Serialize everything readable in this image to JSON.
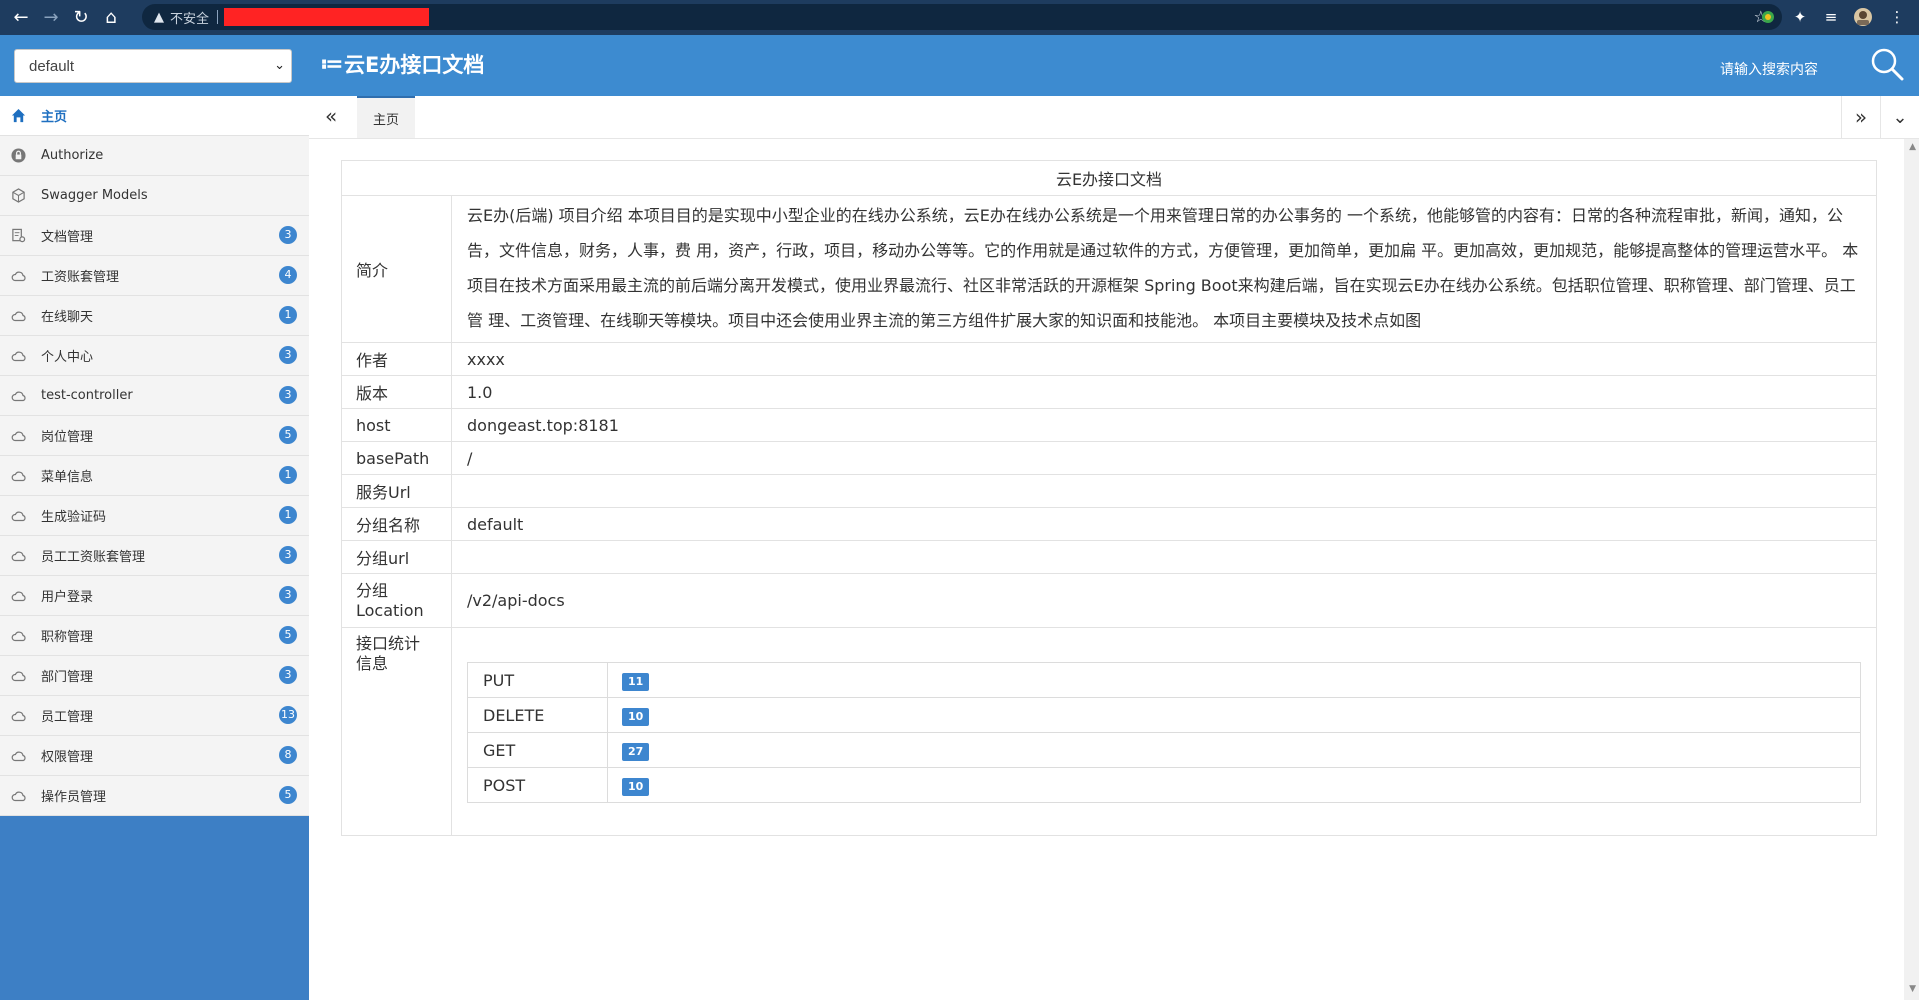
{
  "browser": {
    "insecure_label": "不安全",
    "colors": {
      "chrome": "#1e3c5f",
      "redaction": "#ff2323"
    }
  },
  "header": {
    "group_value": "default",
    "title": "云E办接口文档",
    "search_placeholder": "请输入搜索内容",
    "color": "#3d8bd0"
  },
  "sidebar": {
    "items": [
      {
        "label": "主页",
        "icon": "home-icon",
        "badge": null
      },
      {
        "label": "Authorize",
        "icon": "lock-icon",
        "badge": null
      },
      {
        "label": "Swagger Models",
        "icon": "cube-icon",
        "badge": null
      },
      {
        "label": "文档管理",
        "icon": "document-settings-icon",
        "badge": "3"
      },
      {
        "label": "工资账套管理",
        "icon": "cloud-icon",
        "badge": "4"
      },
      {
        "label": "在线聊天",
        "icon": "cloud-icon",
        "badge": "1"
      },
      {
        "label": "个人中心",
        "icon": "cloud-icon",
        "badge": "3"
      },
      {
        "label": "test-controller",
        "icon": "cloud-icon",
        "badge": "3"
      },
      {
        "label": "岗位管理",
        "icon": "cloud-icon",
        "badge": "5"
      },
      {
        "label": "菜单信息",
        "icon": "cloud-icon",
        "badge": "1"
      },
      {
        "label": "生成验证码",
        "icon": "cloud-icon",
        "badge": "1"
      },
      {
        "label": "员工工资账套管理",
        "icon": "cloud-icon",
        "badge": "3"
      },
      {
        "label": "用户登录",
        "icon": "cloud-icon",
        "badge": "3"
      },
      {
        "label": "职称管理",
        "icon": "cloud-icon",
        "badge": "5"
      },
      {
        "label": "部门管理",
        "icon": "cloud-icon",
        "badge": "3"
      },
      {
        "label": "员工管理",
        "icon": "cloud-icon",
        "badge": "13"
      },
      {
        "label": "权限管理",
        "icon": "cloud-icon",
        "badge": "8"
      },
      {
        "label": "操作员管理",
        "icon": "cloud-icon",
        "badge": "5"
      }
    ]
  },
  "tabs": {
    "home_label": "主页"
  },
  "doc": {
    "title": "云E办接口文档",
    "intro_label": "简介",
    "intro_text": "云E办(后端) 项目介绍 本项目目的是实现中小型企业的在线办公系统，云E办在线办公系统是一个用来管理日常的办公事务的 一个系统，他能够管的内容有：日常的各种流程审批，新闻，通知，公告，文件信息，财务，人事，费 用，资产，行政，项目，移动办公等等。它的作用就是通过软件的方式，方便管理，更加简单，更加扁 平。更加高效，更加规范，能够提高整体的管理运营水平。 本项目在技术方面采用最主流的前后端分离开发模式，使用业界最流行、社区非常活跃的开源框架 Spring Boot来构建后端，旨在实现云E办在线办公系统。包括职位管理、职称管理、部门管理、员工管 理、工资管理、在线聊天等模块。项目中还会使用业界主流的第三方组件扩展大家的知识面和技能池。 本项目主要模块及技术点如图",
    "rows": [
      {
        "key": "作者",
        "value": "xxxx"
      },
      {
        "key": "版本",
        "value": "1.0"
      },
      {
        "key": "host",
        "value": "dongeast.top:8181"
      },
      {
        "key": "basePath",
        "value": "/"
      },
      {
        "key": "服务Url",
        "value": ""
      },
      {
        "key": "分组名称",
        "value": "default"
      },
      {
        "key": "分组url",
        "value": ""
      }
    ],
    "location_label": "分组\nLocation",
    "location_value": "/v2/api-docs",
    "stats_label": "接口统计\n信息",
    "stats": [
      {
        "method": "PUT",
        "count": "11"
      },
      {
        "method": "DELETE",
        "count": "10"
      },
      {
        "method": "GET",
        "count": "27"
      },
      {
        "method": "POST",
        "count": "10"
      }
    ]
  }
}
